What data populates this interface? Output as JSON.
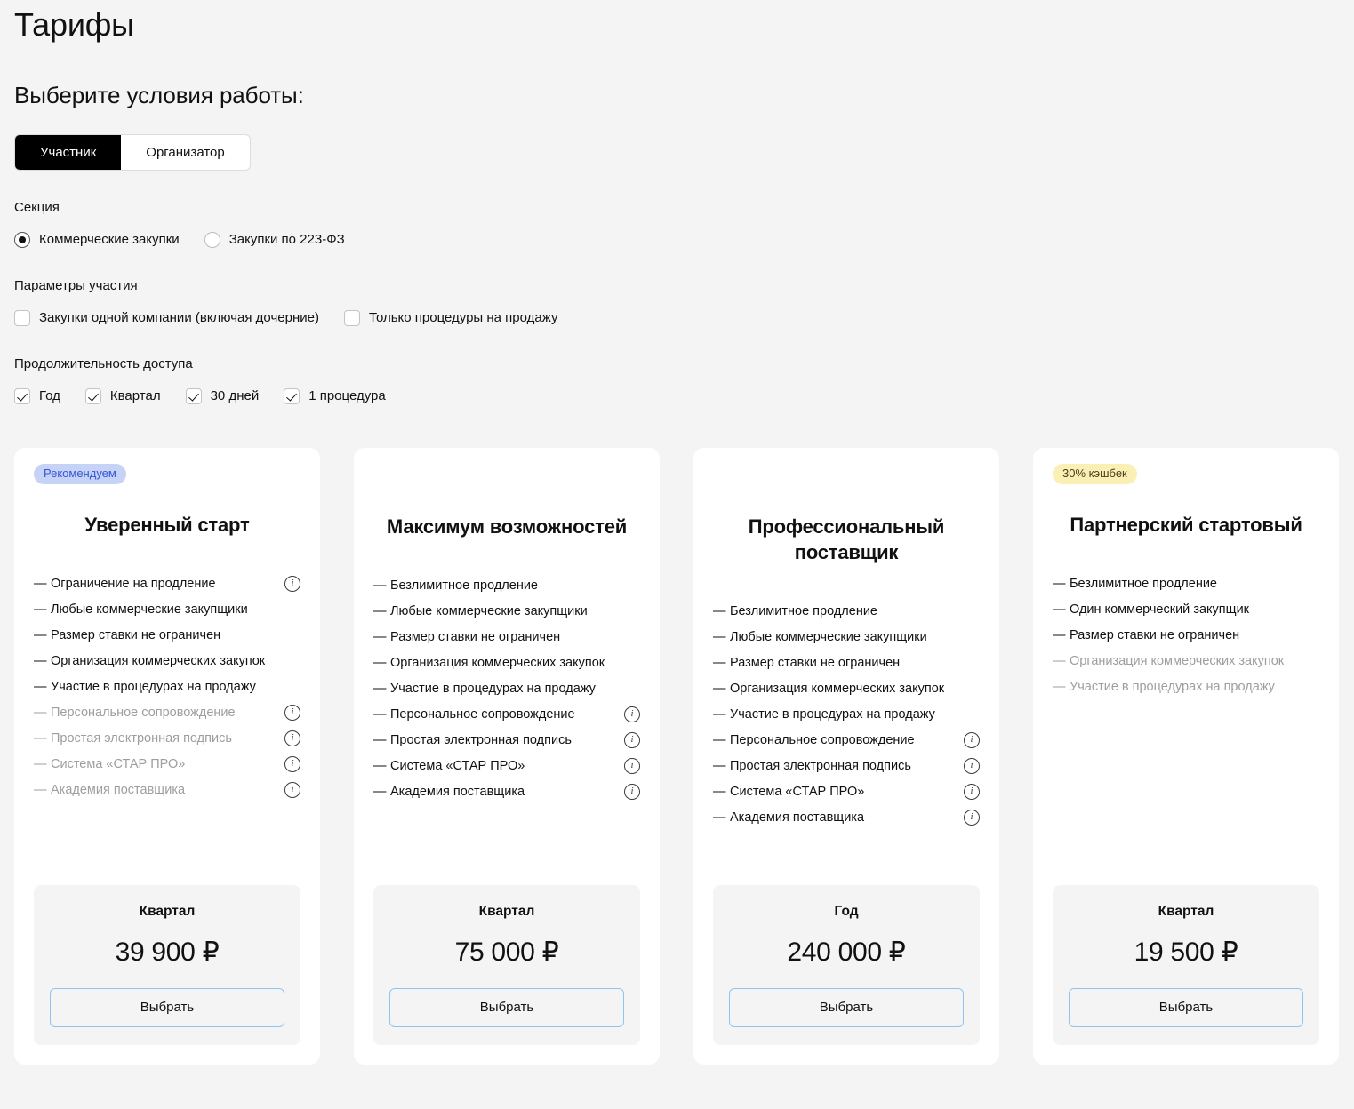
{
  "page": {
    "title": "Тарифы",
    "subtitle": "Выберите условия работы:"
  },
  "role_toggle": {
    "name": "role-toggle",
    "options": [
      {
        "label": "Участник",
        "selected": true
      },
      {
        "label": "Организатор",
        "selected": false
      }
    ]
  },
  "filters": {
    "section": {
      "label": "Секция",
      "type": "radio",
      "options": [
        {
          "label": "Коммерческие закупки",
          "checked": true
        },
        {
          "label": "Закупки по 223-ФЗ",
          "checked": false
        }
      ]
    },
    "participation": {
      "label": "Параметры участия",
      "type": "checkbox",
      "options": [
        {
          "label": "Закупки одной компании (включая дочерние)",
          "checked": false
        },
        {
          "label": "Только процедуры на продажу",
          "checked": false
        }
      ]
    },
    "duration": {
      "label": "Продолжительность доступа",
      "type": "checkbox",
      "options": [
        {
          "label": "Год",
          "checked": true
        },
        {
          "label": "Квартал",
          "checked": true
        },
        {
          "label": "30 дней",
          "checked": true
        },
        {
          "label": "1 процедура",
          "checked": true
        }
      ]
    }
  },
  "colors": {
    "page_background": "#f4f4f4",
    "card_background": "#ffffff",
    "badge_recommended_bg": "#c7d2f7",
    "badge_recommended_text": "#3557d6",
    "badge_cashback_bg": "#faf0b4",
    "badge_cashback_text": "#4a4220",
    "button_border": "#8ec5f0",
    "toggle_active_bg": "#000000",
    "muted_text": "#9e9e9e"
  },
  "cards": [
    {
      "badge": {
        "text": "Рекомендуем",
        "style": "recommended"
      },
      "title": "Уверенный старт",
      "features": [
        {
          "text": "Ограничение на продление",
          "muted": false,
          "info": true
        },
        {
          "text": "Любые коммерческие закупщики",
          "muted": false,
          "info": false
        },
        {
          "text": "Размер ставки не ограничен",
          "muted": false,
          "info": false
        },
        {
          "text": "Организация коммерческих закупок",
          "muted": false,
          "info": false
        },
        {
          "text": "Участие в процедурах на продажу",
          "muted": false,
          "info": false
        },
        {
          "text": "Персональное сопровождение",
          "muted": true,
          "info": true
        },
        {
          "text": "Простая электронная подпись",
          "muted": true,
          "info": true
        },
        {
          "text": "Система «СТАР ПРО»",
          "muted": true,
          "info": true
        },
        {
          "text": "Академия поставщика",
          "muted": true,
          "info": true
        }
      ],
      "period": "Квартал",
      "price": "39 900 ₽",
      "cta": "Выбрать"
    },
    {
      "badge": null,
      "title": "Максимум возможностей",
      "features": [
        {
          "text": "Безлимитное продление",
          "muted": false,
          "info": false
        },
        {
          "text": "Любые коммерческие закупщики",
          "muted": false,
          "info": false
        },
        {
          "text": "Размер ставки не ограничен",
          "muted": false,
          "info": false
        },
        {
          "text": "Организация коммерческих закупок",
          "muted": false,
          "info": false
        },
        {
          "text": "Участие в процедурах на продажу",
          "muted": false,
          "info": false
        },
        {
          "text": "Персональное сопровождение",
          "muted": false,
          "info": true
        },
        {
          "text": "Простая электронная подпись",
          "muted": false,
          "info": true
        },
        {
          "text": "Система «СТАР ПРО»",
          "muted": false,
          "info": true
        },
        {
          "text": "Академия поставщика",
          "muted": false,
          "info": true
        }
      ],
      "period": "Квартал",
      "price": "75 000 ₽",
      "cta": "Выбрать"
    },
    {
      "badge": null,
      "title": "Профессиональный поставщик",
      "features": [
        {
          "text": "Безлимитное продление",
          "muted": false,
          "info": false
        },
        {
          "text": "Любые коммерческие закупщики",
          "muted": false,
          "info": false
        },
        {
          "text": "Размер ставки не ограничен",
          "muted": false,
          "info": false
        },
        {
          "text": "Организация коммерческих закупок",
          "muted": false,
          "info": false
        },
        {
          "text": "Участие в процедурах на продажу",
          "muted": false,
          "info": false
        },
        {
          "text": "Персональное сопровождение",
          "muted": false,
          "info": true
        },
        {
          "text": "Простая электронная подпись",
          "muted": false,
          "info": true
        },
        {
          "text": "Система «СТАР ПРО»",
          "muted": false,
          "info": true
        },
        {
          "text": "Академия поставщика",
          "muted": false,
          "info": true
        }
      ],
      "period": "Год",
      "price": "240 000 ₽",
      "cta": "Выбрать"
    },
    {
      "badge": {
        "text": "30% кэшбек",
        "style": "cashback"
      },
      "title": "Партнерский стартовый",
      "features": [
        {
          "text": "Безлимитное продление",
          "muted": false,
          "info": false
        },
        {
          "text": "Один коммерческий закупщик",
          "muted": false,
          "info": false
        },
        {
          "text": "Размер ставки не ограничен",
          "muted": false,
          "info": false
        },
        {
          "text": "Организация коммерческих закупок",
          "muted": true,
          "info": false
        },
        {
          "text": "Участие в процедурах на продажу",
          "muted": true,
          "info": false
        }
      ],
      "period": "Квартал",
      "price": "19 500 ₽",
      "cta": "Выбрать"
    }
  ],
  "icons": {
    "info": "ⓘ",
    "dash": "—"
  }
}
